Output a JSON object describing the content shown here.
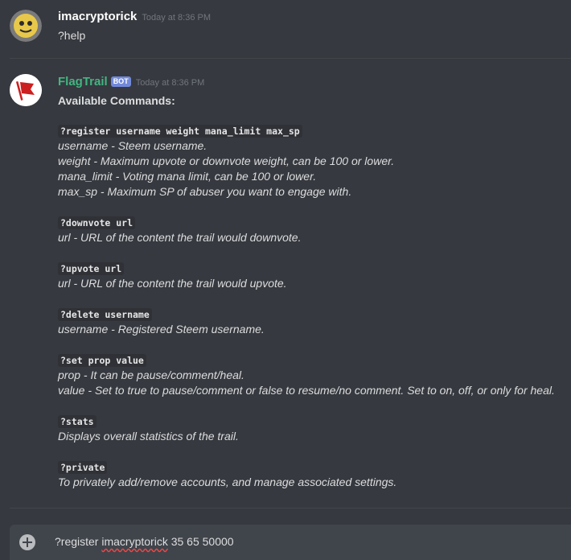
{
  "messages": [
    {
      "author": "imacryptorick",
      "author_color": "#ffffff",
      "timestamp": "Today at 8:36 PM",
      "text": "?help"
    },
    {
      "author": "FlagTrail",
      "author_color": "#43b581",
      "bot_tag": "BOT",
      "timestamp": "Today at 8:36 PM",
      "heading": "Available Commands:",
      "lines": [
        {
          "code": "?register username weight mana_limit max_sp"
        },
        {
          "italic": "username - Steem username."
        },
        {
          "italic": "weight - Maximum upvote or downvote weight, can be 100 or lower."
        },
        {
          "italic": "mana_limit - Voting mana limit, can be 100 or lower."
        },
        {
          "italic": "max_sp - Maximum SP of abuser you want to engage with."
        },
        {
          "code": "?downvote url"
        },
        {
          "italic": "url - URL of the content the trail would downvote."
        },
        {
          "code": "?upvote url"
        },
        {
          "italic": "url - URL of the content the trail would upvote."
        },
        {
          "code": "?delete username"
        },
        {
          "italic": "username - Registered Steem username."
        },
        {
          "code": "?set prop value"
        },
        {
          "italic": "prop - It can be pause/comment/heal."
        },
        {
          "italic": "value - Set to true to pause/comment or false to resume/no comment. Set to on, off, or only for heal."
        },
        {
          "code": "?stats"
        },
        {
          "italic": "Displays overall statistics of the trail."
        },
        {
          "code": "?private"
        },
        {
          "italic": "To privately add/remove accounts, and manage associated settings."
        }
      ]
    }
  ],
  "input": {
    "prefix": "?register ",
    "misspelled": "imacryptorick",
    "suffix": " 35 65 50000"
  },
  "icons": {
    "attach": "plus-circle-icon"
  }
}
